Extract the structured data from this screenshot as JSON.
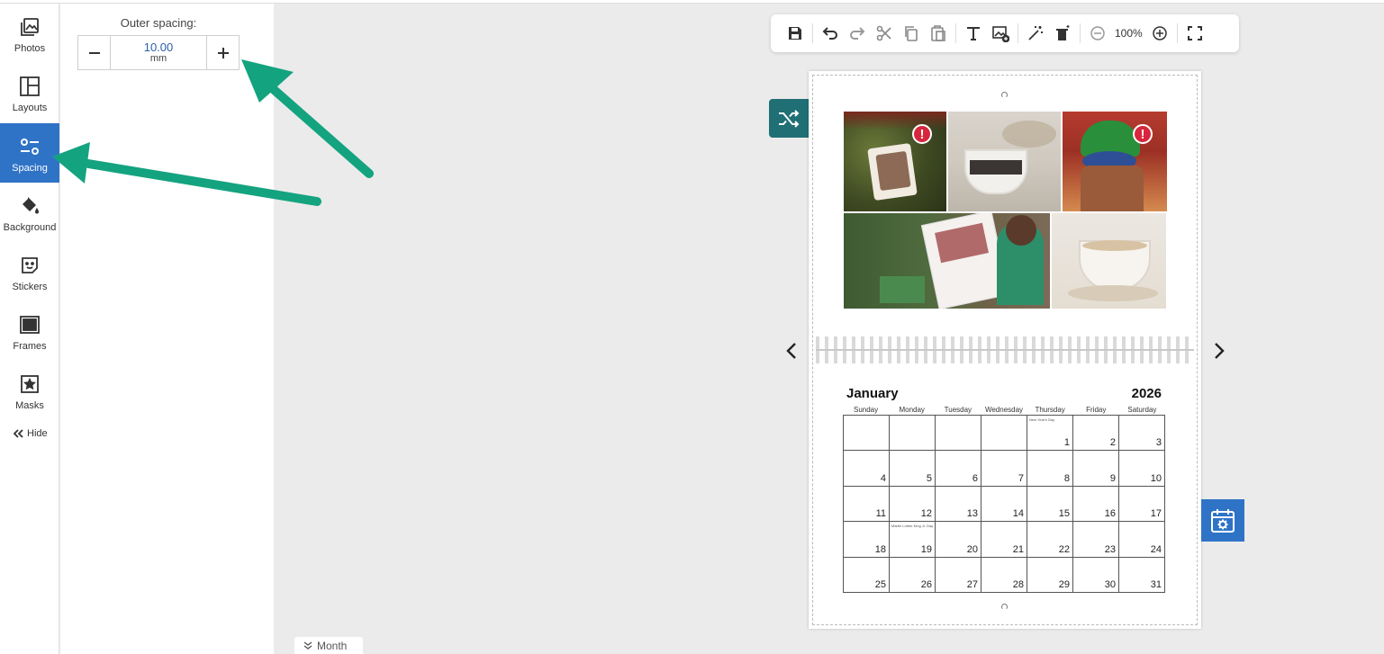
{
  "sidebar": {
    "items": [
      {
        "label": "Photos",
        "icon": "photos-icon"
      },
      {
        "label": "Layouts",
        "icon": "layouts-icon"
      },
      {
        "label": "Spacing",
        "icon": "spacing-icon",
        "active": true
      },
      {
        "label": "Background",
        "icon": "paint-bucket-icon"
      },
      {
        "label": "Stickers",
        "icon": "sticker-icon"
      },
      {
        "label": "Frames",
        "icon": "frame-icon"
      },
      {
        "label": "Masks",
        "icon": "mask-icon"
      }
    ],
    "hide_label": "Hide",
    "active_color": "#2f73c7"
  },
  "panel": {
    "label": "Outer spacing:",
    "value": "10.00",
    "unit": "mm"
  },
  "toolbar": {
    "zoom": "100%"
  },
  "calendar": {
    "month": "January",
    "year": "2026",
    "weekdays": [
      "Sunday",
      "Monday",
      "Tuesday",
      "Wednesday",
      "Thursday",
      "Friday",
      "Saturday"
    ],
    "weeks": [
      [
        "",
        "",
        "",
        "",
        "1",
        "2",
        "3"
      ],
      [
        "4",
        "5",
        "6",
        "7",
        "8",
        "9",
        "10"
      ],
      [
        "11",
        "12",
        "13",
        "14",
        "15",
        "16",
        "17"
      ],
      [
        "18",
        "19",
        "20",
        "21",
        "22",
        "23",
        "24"
      ],
      [
        "25",
        "26",
        "27",
        "28",
        "29",
        "30",
        "31"
      ]
    ],
    "holidays": {
      "1": "New Year's Day",
      "19": "Martin Luther King Jr. Day"
    }
  },
  "bottom_tab": {
    "label": "Month"
  },
  "colors": {
    "accent": "#2f73c7",
    "shuffle": "#1f6f74",
    "annotation_arrow": "#14a37f",
    "warning": "#d7263d"
  }
}
